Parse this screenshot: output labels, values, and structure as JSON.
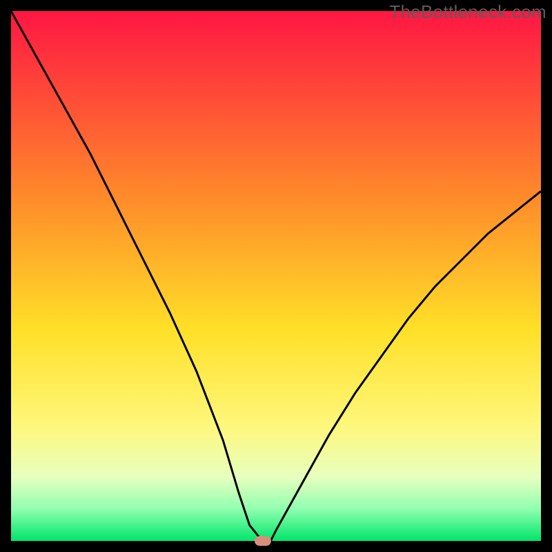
{
  "watermark": "TheBottleneck.com",
  "colors": {
    "frame_background": "#000000",
    "gradient_stops": [
      {
        "pct": 0,
        "color": "#ff1643"
      },
      {
        "pct": 35,
        "color": "#ff8a2a"
      },
      {
        "pct": 60,
        "color": "#ffe028"
      },
      {
        "pct": 78,
        "color": "#fff77a"
      },
      {
        "pct": 88,
        "color": "#e7ffbf"
      },
      {
        "pct": 94,
        "color": "#8fffb0"
      },
      {
        "pct": 100,
        "color": "#00e56a"
      }
    ],
    "curve_stroke": "#000000",
    "marker_fill": "#d98e7a"
  },
  "chart_data": {
    "type": "line",
    "title": "",
    "xlabel": "",
    "ylabel": "",
    "xlim": [
      0,
      100
    ],
    "ylim": [
      0,
      100
    ],
    "grid": false,
    "legend": false,
    "series": [
      {
        "name": "bottleneck-curve",
        "x": [
          0,
          5,
          10,
          15,
          20,
          25,
          30,
          35,
          40,
          43,
          45,
          47,
          49,
          50,
          55,
          60,
          65,
          70,
          75,
          80,
          85,
          90,
          95,
          100
        ],
        "y": [
          100,
          91,
          82,
          73,
          63,
          53,
          43,
          32,
          19,
          9,
          3,
          0.5,
          0,
          2,
          11,
          20,
          28,
          35,
          42,
          48,
          53,
          58,
          62,
          66
        ]
      }
    ],
    "annotations": [
      {
        "name": "min-marker",
        "x": 47.5,
        "y": 0
      }
    ]
  }
}
